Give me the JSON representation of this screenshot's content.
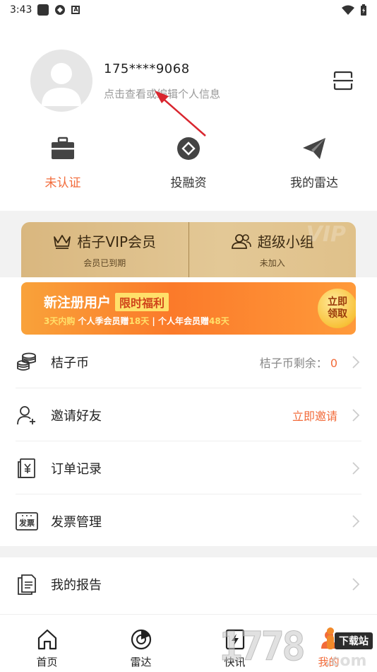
{
  "status_bar": {
    "time": "3:43",
    "notif_letter": "A"
  },
  "profile": {
    "phone": "175****9068",
    "hint": "点击查看或编辑个人信息"
  },
  "shortcuts": [
    {
      "label": "未认证",
      "icon": "briefcase-icon",
      "warn": true
    },
    {
      "label": "投融资",
      "icon": "diamond-icon",
      "warn": false
    },
    {
      "label": "我的雷达",
      "icon": "paper-plane-icon",
      "warn": false
    }
  ],
  "vip": {
    "left_title": "桔子VIP会员",
    "left_sub": "会员已到期",
    "right_title": "超级小组",
    "right_sub": "未加入",
    "watermark": "VIP"
  },
  "promo": {
    "title": "新注册用户",
    "tag": "限时福利",
    "sub_a_hl": "3天内购",
    "sub_a": " 个人季会员赠",
    "sub_a_num": "18天",
    "sub_sep": " | ",
    "sub_b": "个人年会员赠",
    "sub_b_num": "48天",
    "button_line1": "立即",
    "button_line2": "领取"
  },
  "list": [
    {
      "label": "桔子币",
      "icon": "coins-icon",
      "right": "桔子币剩余：",
      "right_num": "0"
    },
    {
      "label": "邀请好友",
      "icon": "add-user-icon",
      "right": "立即邀请",
      "warn": true
    },
    {
      "label": "订单记录",
      "icon": "order-icon",
      "right": ""
    },
    {
      "label": "发票管理",
      "icon": "invoice-icon",
      "right": "",
      "invoice_text": "发票"
    }
  ],
  "list2": [
    {
      "label": "我的报告",
      "icon": "report-icon",
      "right": ""
    }
  ],
  "bottom_nav": [
    {
      "label": "首页",
      "icon": "home-icon",
      "active": false
    },
    {
      "label": "雷达",
      "icon": "radar-icon",
      "active": false
    },
    {
      "label": "快讯",
      "icon": "flash-icon",
      "active": false
    },
    {
      "label": "我的",
      "icon": "profile-icon",
      "active": true
    }
  ],
  "watermark": {
    "digits": "1778",
    "com": ".com",
    "badge": "下载站"
  },
  "colors": {
    "accent": "#f26b3a",
    "vip_gold": "#e3c896",
    "promo_orange": "#fb7a2a"
  }
}
